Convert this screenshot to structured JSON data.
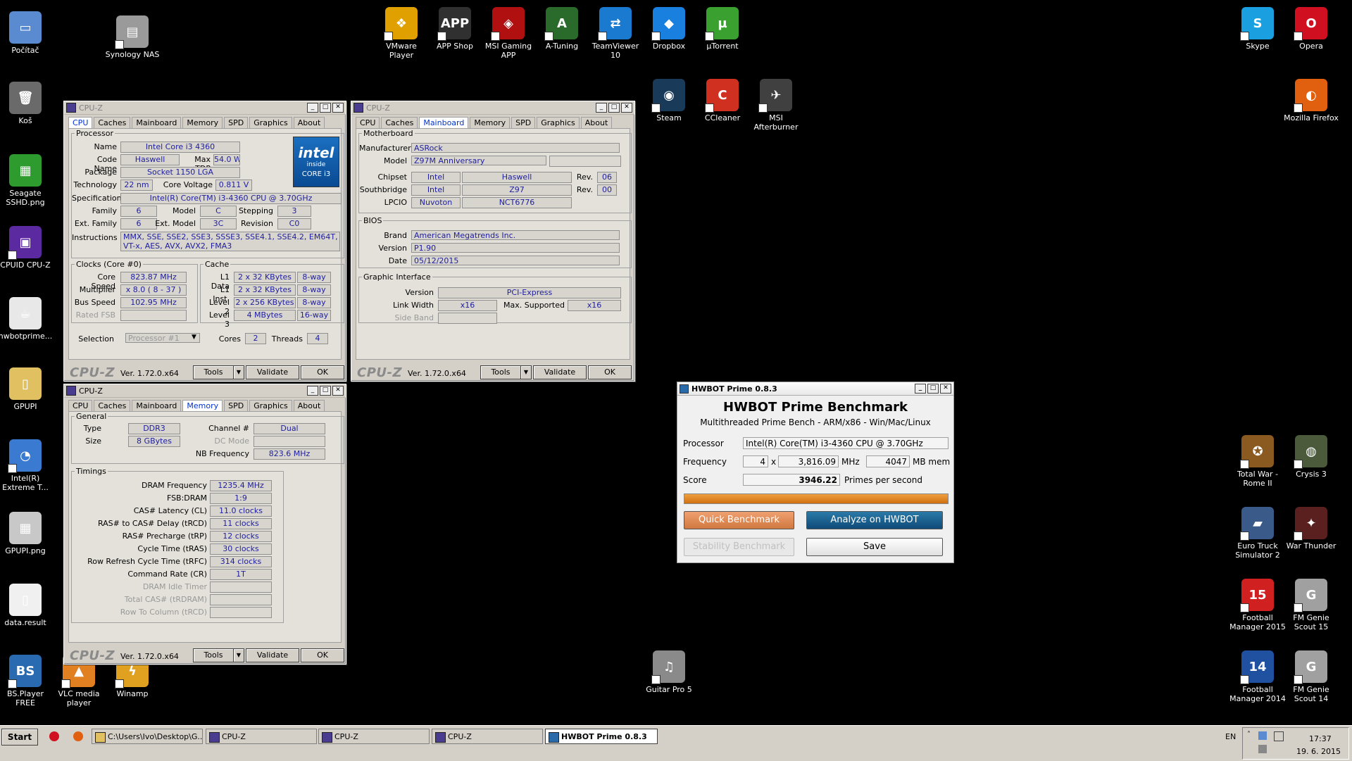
{
  "desktop": {
    "icons": [
      {
        "label": "Počítač",
        "color": "#5a8ad0",
        "glyph": "▭",
        "arrow": false
      },
      {
        "label": "Synology NAS",
        "color": "#9a9a9a",
        "glyph": "▤"
      },
      {
        "label": "Koš",
        "color": "#6a6a6a",
        "glyph": "🗑",
        "arrow": false
      },
      {
        "label": "Seagate SSHD.png",
        "color": "#2d9b2d",
        "glyph": "▦",
        "arrow": false
      },
      {
        "label": "CPUID CPU-Z",
        "color": "#5b2aa0",
        "glyph": "▣"
      },
      {
        "label": "hwbotprime...",
        "color": "#e8e8e8",
        "glyph": "☕",
        "arrow": false
      },
      {
        "label": "GPUPI",
        "color": "#e0c060",
        "glyph": "▯",
        "arrow": false
      },
      {
        "label": "Intel(R) Extreme T...",
        "color": "#3a7ad0",
        "glyph": "◔"
      },
      {
        "label": "GPUPI.png",
        "color": "#c8c8c8",
        "glyph": "▦",
        "arrow": false
      },
      {
        "label": "data.result",
        "color": "#f0f0f0",
        "glyph": "▯",
        "arrow": false
      },
      {
        "label": "BS.Player FREE",
        "color": "#2a6ab0",
        "glyph": "BS"
      },
      {
        "label": "VLC media player",
        "color": "#e08020",
        "glyph": "▲"
      },
      {
        "label": "Winamp",
        "color": "#e0a020",
        "glyph": "ϟ"
      },
      {
        "label": "VMware Player",
        "color": "#e0a000",
        "glyph": "❖"
      },
      {
        "label": "APP Shop",
        "color": "#303030",
        "glyph": "APP"
      },
      {
        "label": "MSI Gaming APP",
        "color": "#b01010",
        "glyph": "◈"
      },
      {
        "label": "A-Tuning",
        "color": "#2a6a2a",
        "glyph": "A"
      },
      {
        "label": "TeamViewer 10",
        "color": "#1a7ad0",
        "glyph": "⇄"
      },
      {
        "label": "Dropbox",
        "color": "#1a80e0",
        "glyph": "◆"
      },
      {
        "label": "µTorrent",
        "color": "#3aa030",
        "glyph": "µ"
      },
      {
        "label": "Steam",
        "color": "#1a3a5a",
        "glyph": "◉"
      },
      {
        "label": "CCleaner",
        "color": "#d03020",
        "glyph": "C"
      },
      {
        "label": "MSI Afterburner",
        "color": "#404040",
        "glyph": "✈"
      },
      {
        "label": "Skype",
        "color": "#1aa0e0",
        "glyph": "S"
      },
      {
        "label": "Opera",
        "color": "#d01020",
        "glyph": "O"
      },
      {
        "label": "Mozilla Firefox",
        "color": "#e06010",
        "glyph": "◐"
      },
      {
        "label": "Total War - Rome II",
        "color": "#8a5a20",
        "glyph": "✪"
      },
      {
        "label": "Crysis 3",
        "color": "#4a5a3a",
        "glyph": "◍"
      },
      {
        "label": "Euro Truck Simulator 2",
        "color": "#3a5a8a",
        "glyph": "▰"
      },
      {
        "label": "War Thunder",
        "color": "#5a2020",
        "glyph": "✦"
      },
      {
        "label": "Football Manager 2015",
        "color": "#d02020",
        "glyph": "15"
      },
      {
        "label": "FM Genie Scout 15",
        "color": "#a0a0a0",
        "glyph": "G"
      },
      {
        "label": "Football Manager 2014",
        "color": "#2050a0",
        "glyph": "14"
      },
      {
        "label": "FM Genie Scout 14",
        "color": "#a0a0a0",
        "glyph": "G"
      },
      {
        "label": "Guitar Pro 5",
        "color": "#8a8a8a",
        "glyph": "♫"
      }
    ]
  },
  "cpuz_common": {
    "title": "CPU-Z",
    "tabs": [
      "CPU",
      "Caches",
      "Mainboard",
      "Memory",
      "SPD",
      "Graphics",
      "About"
    ],
    "logo": "CPU-Z",
    "version": "Ver. 1.72.0.x64",
    "tools": "Tools",
    "validate": "Validate",
    "ok": "OK"
  },
  "cpu_tab": {
    "processor_legend": "Processor",
    "name_label": "Name",
    "name": "Intel Core i3 4360",
    "codename_label": "Code Name",
    "codename": "Haswell",
    "maxtdp_label": "Max TDP",
    "maxtdp": "54.0 W",
    "package_label": "Package",
    "package": "Socket 1150 LGA",
    "technology_label": "Technology",
    "technology": "22 nm",
    "corevoltage_label": "Core Voltage",
    "corevoltage": "0.811 V",
    "spec_label": "Specification",
    "spec": "Intel(R) Core(TM) i3-4360 CPU @ 3.70GHz",
    "family_label": "Family",
    "family": "6",
    "model_label": "Model",
    "model": "C",
    "stepping_label": "Stepping",
    "stepping": "3",
    "extfamily_label": "Ext. Family",
    "extfamily": "6",
    "extmodel_label": "Ext. Model",
    "extmodel": "3C",
    "revision_label": "Revision",
    "revision": "C0",
    "instructions_label": "Instructions",
    "instructions": "MMX, SSE, SSE2, SSE3, SSSE3, SSE4.1, SSE4.2, EM64T, VT-x, AES, AVX, AVX2, FMA3",
    "intel_logo": {
      "brand": "intel",
      "inside": "inside",
      "line": "CORE i3"
    },
    "clocks_legend": "Clocks (Core #0)",
    "corespeed_label": "Core Speed",
    "corespeed": "823.87 MHz",
    "multiplier_label": "Multiplier",
    "multiplier": "x 8.0 ( 8 - 37 )",
    "busspeed_label": "Bus Speed",
    "busspeed": "102.95 MHz",
    "ratedfsb_label": "Rated FSB",
    "cache_legend": "Cache",
    "l1data_label": "L1 Data",
    "l1data": "2 x 32 KBytes",
    "l1data_way": "8-way",
    "l1inst_label": "L1 Inst.",
    "l1inst": "2 x 32 KBytes",
    "l1inst_way": "8-way",
    "level2_label": "Level 2",
    "level2": "2 x 256 KBytes",
    "level2_way": "8-way",
    "level3_label": "Level 3",
    "level3": "4 MBytes",
    "level3_way": "16-way",
    "selection_label": "Selection",
    "selection": "Processor #1",
    "cores_label": "Cores",
    "cores": "2",
    "threads_label": "Threads",
    "threads": "4"
  },
  "mainboard_tab": {
    "motherboard_legend": "Motherboard",
    "manufacturer_label": "Manufacturer",
    "manufacturer": "ASRock",
    "model_label": "Model",
    "model": "Z97M Anniversary",
    "chipset_label": "Chipset",
    "chipset_vendor": "Intel",
    "chipset_name": "Haswell",
    "chipset_rev_label": "Rev.",
    "chipset_rev": "06",
    "southbridge_label": "Southbridge",
    "sb_vendor": "Intel",
    "sb_name": "Z97",
    "sb_rev_label": "Rev.",
    "sb_rev": "00",
    "lpcio_label": "LPCIO",
    "lpcio_vendor": "Nuvoton",
    "lpcio_name": "NCT6776",
    "bios_legend": "BIOS",
    "brand_label": "Brand",
    "brand": "American Megatrends Inc.",
    "version_label": "Version",
    "version": "P1.90",
    "date_label": "Date",
    "date": "05/12/2015",
    "gi_legend": "Graphic Interface",
    "gi_version_label": "Version",
    "gi_version": "PCI-Express",
    "linkwidth_label": "Link Width",
    "linkwidth": "x16",
    "maxsupported_label": "Max. Supported",
    "maxsupported": "x16",
    "sideband_label": "Side Band"
  },
  "memory_tab": {
    "general_legend": "General",
    "type_label": "Type",
    "type": "DDR3",
    "size_label": "Size",
    "size": "8 GBytes",
    "channel_label": "Channel #",
    "channel": "Dual",
    "dcmode_label": "DC Mode",
    "nbfreq_label": "NB Frequency",
    "nbfreq": "823.6 MHz",
    "timings_legend": "Timings",
    "timings": [
      {
        "label": "DRAM Frequency",
        "value": "1235.4 MHz",
        "dim": false
      },
      {
        "label": "FSB:DRAM",
        "value": "1:9",
        "dim": false
      },
      {
        "label": "CAS# Latency (CL)",
        "value": "11.0 clocks",
        "dim": false
      },
      {
        "label": "RAS# to CAS# Delay (tRCD)",
        "value": "11 clocks",
        "dim": false
      },
      {
        "label": "RAS# Precharge (tRP)",
        "value": "12 clocks",
        "dim": false
      },
      {
        "label": "Cycle Time (tRAS)",
        "value": "30 clocks",
        "dim": false
      },
      {
        "label": "Row Refresh Cycle Time (tRFC)",
        "value": "314 clocks",
        "dim": false
      },
      {
        "label": "Command Rate (CR)",
        "value": "1T",
        "dim": false
      },
      {
        "label": "DRAM Idle Timer",
        "value": "",
        "dim": true
      },
      {
        "label": "Total CAS# (tRDRAM)",
        "value": "",
        "dim": true
      },
      {
        "label": "Row To Column (tRCD)",
        "value": "",
        "dim": true
      }
    ]
  },
  "hwbot": {
    "title": "HWBOT Prime 0.8.3",
    "heading": "HWBOT Prime Benchmark",
    "subheading": "Multithreaded Prime Bench - ARM/x86 - Win/Mac/Linux",
    "processor_label": "Processor",
    "processor": "Intel(R) Core(TM) i3-4360 CPU @ 3.70GHz",
    "frequency_label": "Frequency",
    "threads": "4",
    "x": "x",
    "freq": "3,816.09",
    "mhz": "MHz",
    "memory": "4047",
    "mbmem": "MB mem",
    "score_label": "Score",
    "score": "3946.22",
    "score_unit": "Primes per second",
    "progress": 1.0,
    "quick": "Quick Benchmark",
    "analyze": "Analyze on HWBOT",
    "stability": "Stability Benchmark",
    "save": "Save"
  },
  "taskbar": {
    "start": "Start",
    "buttons": [
      "C:\\Users\\Ivo\\Desktop\\G...",
      "CPU-Z",
      "CPU-Z",
      "CPU-Z",
      "HWBOT Prime 0.8.3"
    ],
    "lang": "EN",
    "time": "17:37",
    "date": "19. 6. 2015"
  }
}
